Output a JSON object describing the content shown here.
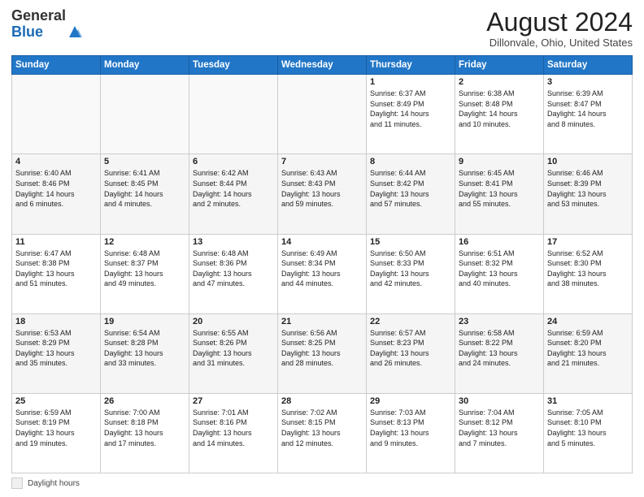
{
  "header": {
    "logo_general": "General",
    "logo_blue": "Blue",
    "title": "August 2024",
    "subtitle": "Dillonvale, Ohio, United States"
  },
  "calendar": {
    "headers": [
      "Sunday",
      "Monday",
      "Tuesday",
      "Wednesday",
      "Thursday",
      "Friday",
      "Saturday"
    ],
    "weeks": [
      {
        "days": [
          {
            "num": "",
            "info": "",
            "empty": true
          },
          {
            "num": "",
            "info": "",
            "empty": true
          },
          {
            "num": "",
            "info": "",
            "empty": true
          },
          {
            "num": "",
            "info": "",
            "empty": true
          },
          {
            "num": "1",
            "info": "Sunrise: 6:37 AM\nSunset: 8:49 PM\nDaylight: 14 hours\nand 11 minutes.",
            "empty": false
          },
          {
            "num": "2",
            "info": "Sunrise: 6:38 AM\nSunset: 8:48 PM\nDaylight: 14 hours\nand 10 minutes.",
            "empty": false
          },
          {
            "num": "3",
            "info": "Sunrise: 6:39 AM\nSunset: 8:47 PM\nDaylight: 14 hours\nand 8 minutes.",
            "empty": false
          }
        ]
      },
      {
        "days": [
          {
            "num": "4",
            "info": "Sunrise: 6:40 AM\nSunset: 8:46 PM\nDaylight: 14 hours\nand 6 minutes.",
            "empty": false
          },
          {
            "num": "5",
            "info": "Sunrise: 6:41 AM\nSunset: 8:45 PM\nDaylight: 14 hours\nand 4 minutes.",
            "empty": false
          },
          {
            "num": "6",
            "info": "Sunrise: 6:42 AM\nSunset: 8:44 PM\nDaylight: 14 hours\nand 2 minutes.",
            "empty": false
          },
          {
            "num": "7",
            "info": "Sunrise: 6:43 AM\nSunset: 8:43 PM\nDaylight: 13 hours\nand 59 minutes.",
            "empty": false
          },
          {
            "num": "8",
            "info": "Sunrise: 6:44 AM\nSunset: 8:42 PM\nDaylight: 13 hours\nand 57 minutes.",
            "empty": false
          },
          {
            "num": "9",
            "info": "Sunrise: 6:45 AM\nSunset: 8:41 PM\nDaylight: 13 hours\nand 55 minutes.",
            "empty": false
          },
          {
            "num": "10",
            "info": "Sunrise: 6:46 AM\nSunset: 8:39 PM\nDaylight: 13 hours\nand 53 minutes.",
            "empty": false
          }
        ]
      },
      {
        "days": [
          {
            "num": "11",
            "info": "Sunrise: 6:47 AM\nSunset: 8:38 PM\nDaylight: 13 hours\nand 51 minutes.",
            "empty": false
          },
          {
            "num": "12",
            "info": "Sunrise: 6:48 AM\nSunset: 8:37 PM\nDaylight: 13 hours\nand 49 minutes.",
            "empty": false
          },
          {
            "num": "13",
            "info": "Sunrise: 6:48 AM\nSunset: 8:36 PM\nDaylight: 13 hours\nand 47 minutes.",
            "empty": false
          },
          {
            "num": "14",
            "info": "Sunrise: 6:49 AM\nSunset: 8:34 PM\nDaylight: 13 hours\nand 44 minutes.",
            "empty": false
          },
          {
            "num": "15",
            "info": "Sunrise: 6:50 AM\nSunset: 8:33 PM\nDaylight: 13 hours\nand 42 minutes.",
            "empty": false
          },
          {
            "num": "16",
            "info": "Sunrise: 6:51 AM\nSunset: 8:32 PM\nDaylight: 13 hours\nand 40 minutes.",
            "empty": false
          },
          {
            "num": "17",
            "info": "Sunrise: 6:52 AM\nSunset: 8:30 PM\nDaylight: 13 hours\nand 38 minutes.",
            "empty": false
          }
        ]
      },
      {
        "days": [
          {
            "num": "18",
            "info": "Sunrise: 6:53 AM\nSunset: 8:29 PM\nDaylight: 13 hours\nand 35 minutes.",
            "empty": false
          },
          {
            "num": "19",
            "info": "Sunrise: 6:54 AM\nSunset: 8:28 PM\nDaylight: 13 hours\nand 33 minutes.",
            "empty": false
          },
          {
            "num": "20",
            "info": "Sunrise: 6:55 AM\nSunset: 8:26 PM\nDaylight: 13 hours\nand 31 minutes.",
            "empty": false
          },
          {
            "num": "21",
            "info": "Sunrise: 6:56 AM\nSunset: 8:25 PM\nDaylight: 13 hours\nand 28 minutes.",
            "empty": false
          },
          {
            "num": "22",
            "info": "Sunrise: 6:57 AM\nSunset: 8:23 PM\nDaylight: 13 hours\nand 26 minutes.",
            "empty": false
          },
          {
            "num": "23",
            "info": "Sunrise: 6:58 AM\nSunset: 8:22 PM\nDaylight: 13 hours\nand 24 minutes.",
            "empty": false
          },
          {
            "num": "24",
            "info": "Sunrise: 6:59 AM\nSunset: 8:20 PM\nDaylight: 13 hours\nand 21 minutes.",
            "empty": false
          }
        ]
      },
      {
        "days": [
          {
            "num": "25",
            "info": "Sunrise: 6:59 AM\nSunset: 8:19 PM\nDaylight: 13 hours\nand 19 minutes.",
            "empty": false
          },
          {
            "num": "26",
            "info": "Sunrise: 7:00 AM\nSunset: 8:18 PM\nDaylight: 13 hours\nand 17 minutes.",
            "empty": false
          },
          {
            "num": "27",
            "info": "Sunrise: 7:01 AM\nSunset: 8:16 PM\nDaylight: 13 hours\nand 14 minutes.",
            "empty": false
          },
          {
            "num": "28",
            "info": "Sunrise: 7:02 AM\nSunset: 8:15 PM\nDaylight: 13 hours\nand 12 minutes.",
            "empty": false
          },
          {
            "num": "29",
            "info": "Sunrise: 7:03 AM\nSunset: 8:13 PM\nDaylight: 13 hours\nand 9 minutes.",
            "empty": false
          },
          {
            "num": "30",
            "info": "Sunrise: 7:04 AM\nSunset: 8:12 PM\nDaylight: 13 hours\nand 7 minutes.",
            "empty": false
          },
          {
            "num": "31",
            "info": "Sunrise: 7:05 AM\nSunset: 8:10 PM\nDaylight: 13 hours\nand 5 minutes.",
            "empty": false
          }
        ]
      }
    ]
  },
  "footer": {
    "daylight_label": "Daylight hours"
  }
}
